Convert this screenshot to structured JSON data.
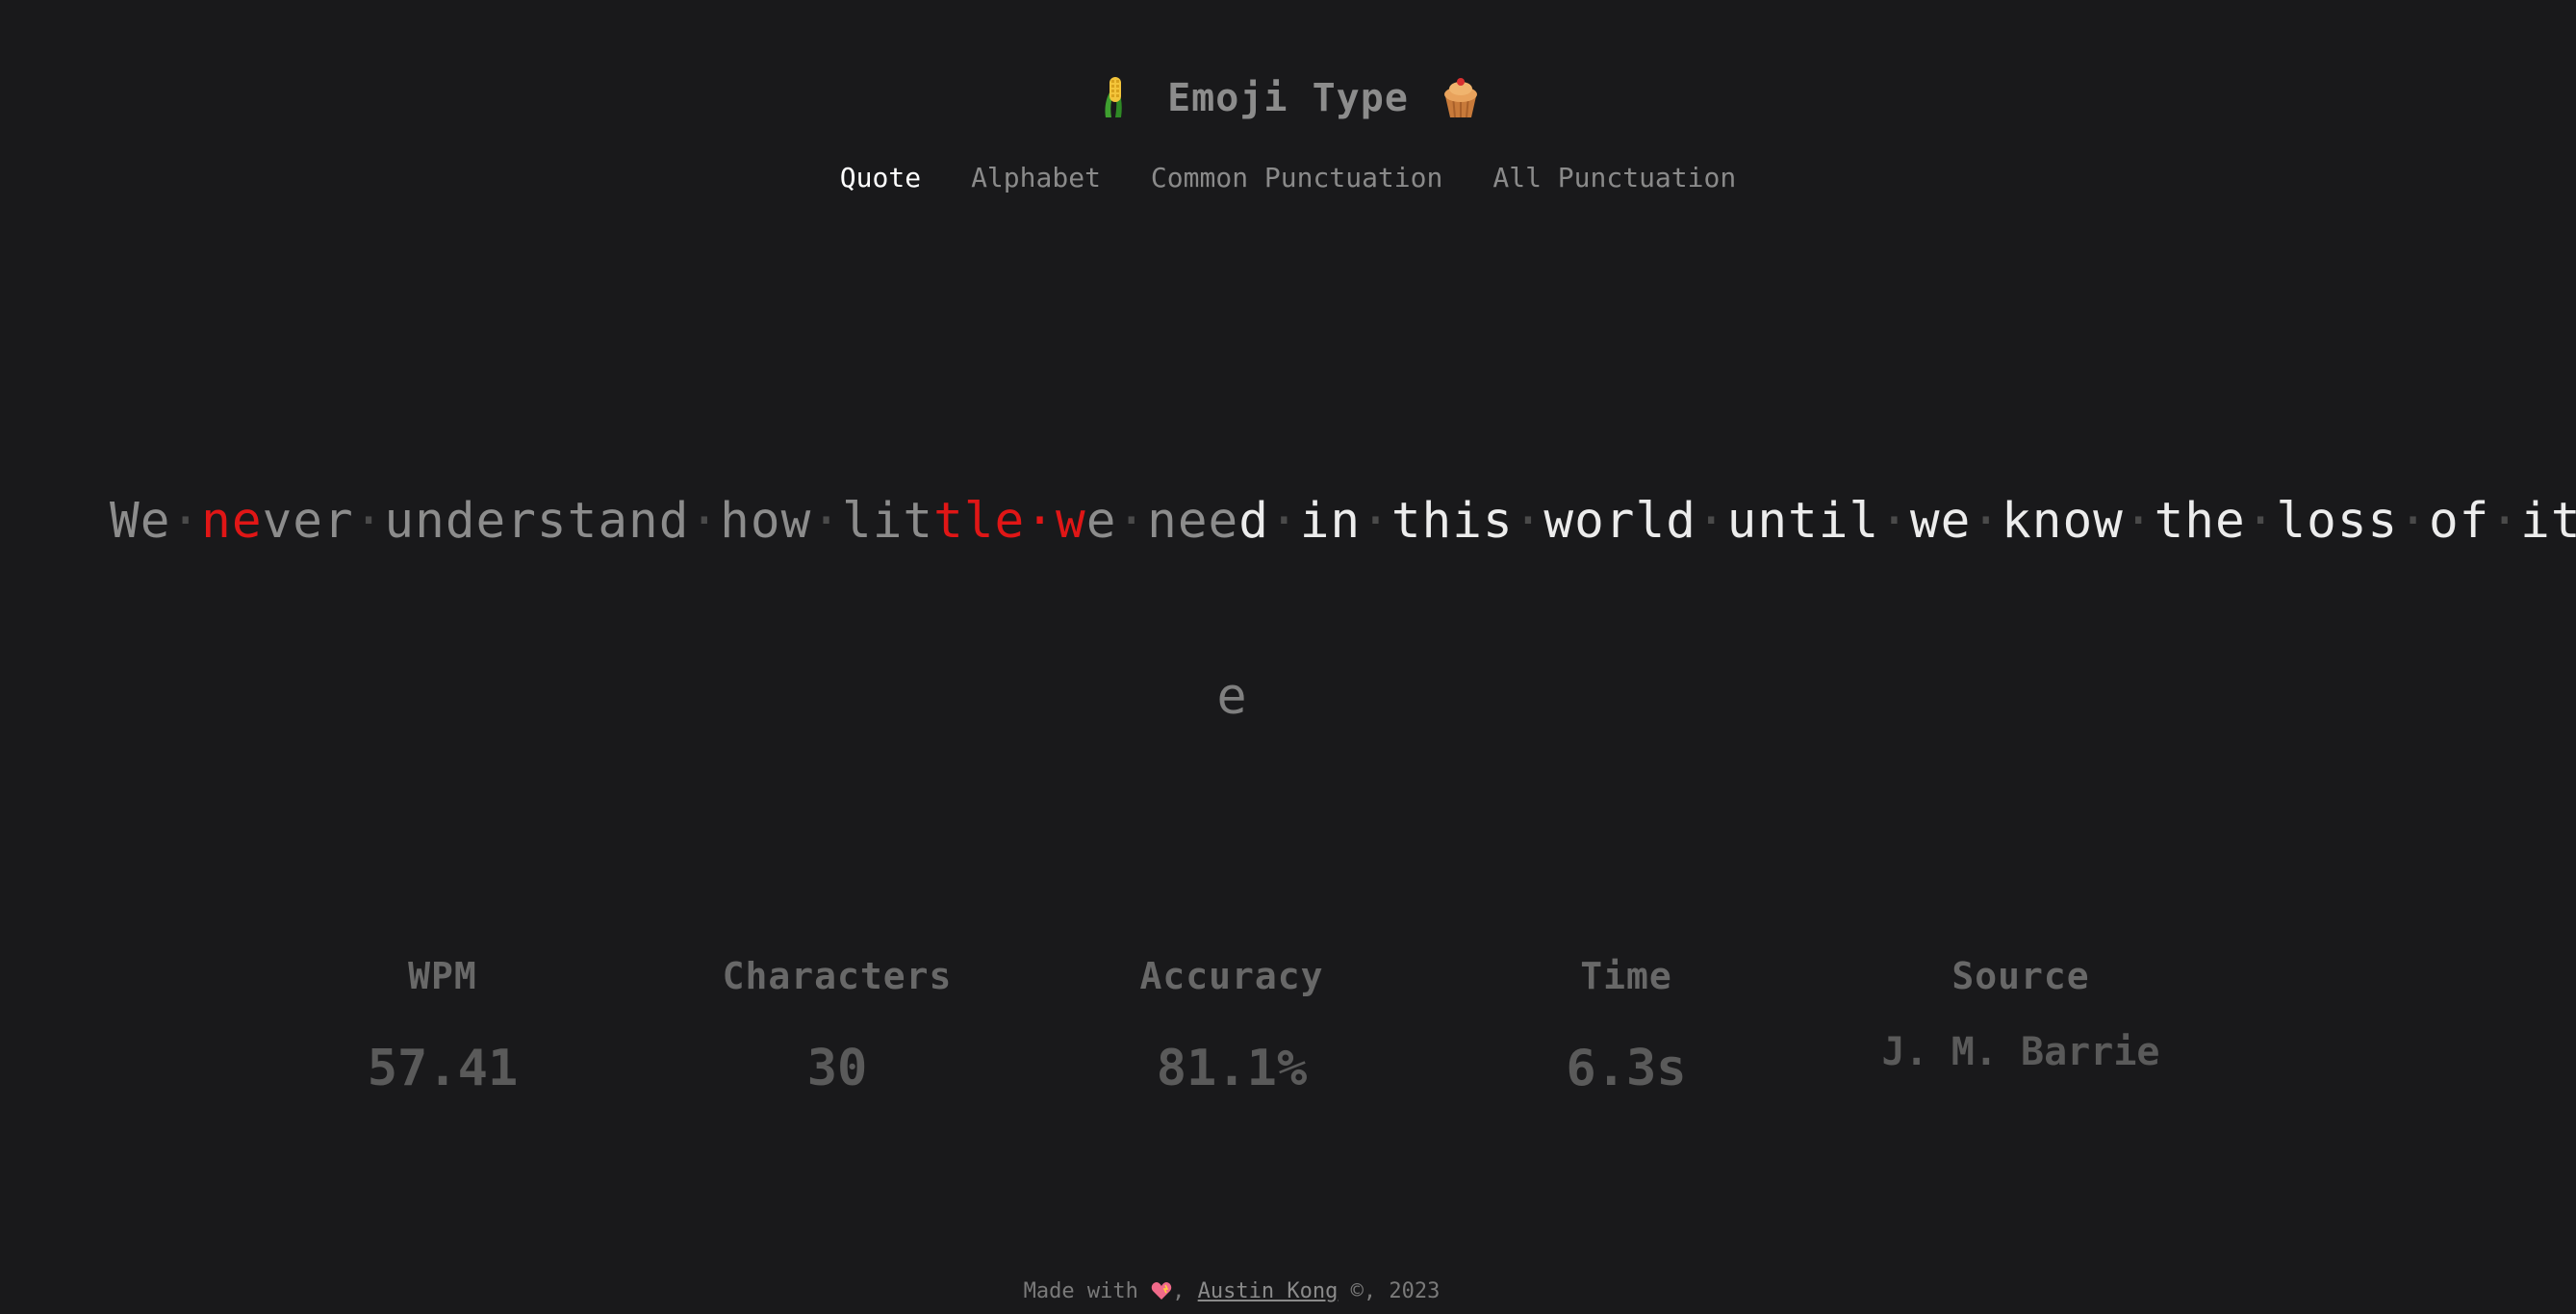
{
  "header": {
    "title": "Emoji Type",
    "left_emoji": "corn-icon",
    "right_emoji": "cupcake-icon"
  },
  "nav": {
    "tabs": [
      {
        "label": "Quote",
        "active": true
      },
      {
        "label": "Alphabet",
        "active": false
      },
      {
        "label": "Common Punctuation",
        "active": false
      },
      {
        "label": "All Punctuation",
        "active": false
      }
    ]
  },
  "quote": {
    "text": "We never understand how little we need in this world until we know the loss of it",
    "typed_correct_prefix_1": "We",
    "error_1": "ne",
    "typed_2": "ver",
    "typed_3": "understand",
    "typed_4": "how",
    "typed_5": "lit",
    "error_2": "tle",
    "error_3": "w",
    "typed_6": "e",
    "typed_7": "nee",
    "cursor_char": "d",
    "remaining": [
      "in",
      "this",
      "world",
      "until",
      "we",
      "know",
      "the",
      "loss",
      "of",
      "it"
    ]
  },
  "typed_preview": "e",
  "stats": {
    "wpm_label": "WPM",
    "wpm_value": "57.41",
    "chars_label": "Characters",
    "chars_value": "30",
    "accuracy_label": "Accuracy",
    "accuracy_value": "81.1%",
    "time_label": "Time",
    "time_value": "6.3s",
    "source_label": "Source",
    "source_value": "J. M. Barrie"
  },
  "footer": {
    "made_with": "Made with",
    "author": "Austin Kong",
    "suffix": "©, 2023"
  },
  "colors": {
    "background": "#19191b",
    "error": "#e01616",
    "cursor": "#f2d51d",
    "active_tab": "#ffffff"
  }
}
